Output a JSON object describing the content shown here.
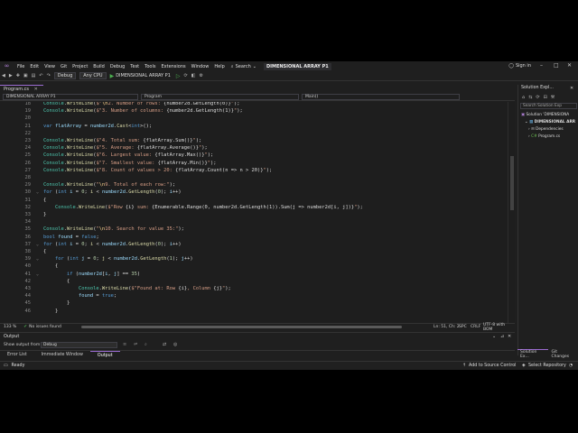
{
  "menubar": {
    "items": [
      "File",
      "Edit",
      "View",
      "Git",
      "Project",
      "Build",
      "Debug",
      "Test",
      "Tools",
      "Extensions",
      "Window",
      "Help"
    ],
    "search_label": "Search",
    "solution_name": "DIMENSIONAL ARRAY P1",
    "sign_in": "Sign in"
  },
  "toolbar": {
    "config": "Debug",
    "platform": "Any CPU",
    "run_target": "DIMENSIONAL ARRAY P1"
  },
  "tabs": [
    {
      "label": "Program.cs"
    }
  ],
  "navbar": {
    "project": "DIMENSIONAL ARRAY P1",
    "class": "Program",
    "member": "Main()"
  },
  "code": {
    "lines": [
      {
        "n": "18",
        "t": "Console.WriteLine($\"\\n2. Number of rows: {number2d.GetLength(0)}\");"
      },
      {
        "n": "19",
        "t": "Console.WriteLine($\"3. Number of columns: {number2d.GetLength(1)}\");"
      },
      {
        "n": "20",
        "t": ""
      },
      {
        "n": "21",
        "t": "var flatArray = number2d.Cast<int>();"
      },
      {
        "n": "22",
        "t": ""
      },
      {
        "n": "23",
        "t": "Console.WriteLine($\"4. Total sum: {flatArray.Sum()}\");"
      },
      {
        "n": "24",
        "t": "Console.WriteLine($\"5. Average: {flatArray.Average()}\");"
      },
      {
        "n": "25",
        "t": "Console.WriteLine($\"6. Largest value: {flatArray.Max()}\");"
      },
      {
        "n": "26",
        "t": "Console.WriteLine($\"7. Smallest value: {flatArray.Min()}\");"
      },
      {
        "n": "27",
        "t": "Console.WriteLine($\"8. Count of values > 20: {flatArray.Count(n => n > 20)}\");"
      },
      {
        "n": "28",
        "t": ""
      },
      {
        "n": "29",
        "t": "Console.WriteLine(\"\\n9. Total of each row:\");"
      },
      {
        "n": "30",
        "t": "for (int i = 0; i < number2d.GetLength(0); i++)"
      },
      {
        "n": "31",
        "t": "{"
      },
      {
        "n": "32",
        "t": "    Console.WriteLine($\"Row {i} sum: {Enumerable.Range(0, number2d.GetLength(1)).Sum(j => number2d[i, j])}\");"
      },
      {
        "n": "33",
        "t": "}"
      },
      {
        "n": "34",
        "t": ""
      },
      {
        "n": "35",
        "t": "Console.WriteLine(\"\\n10. Search for value 35:\");"
      },
      {
        "n": "36",
        "t": "bool found = false;"
      },
      {
        "n": "37",
        "t": "for (int i = 0; i < number2d.GetLength(0); i++)"
      },
      {
        "n": "38",
        "t": "{"
      },
      {
        "n": "39",
        "t": "    for (int j = 0; j < number2d.GetLength(1); j++)"
      },
      {
        "n": "40",
        "t": "    {"
      },
      {
        "n": "41",
        "t": "        if (number2d[i, j] == 35)"
      },
      {
        "n": "42",
        "t": "        {"
      },
      {
        "n": "43",
        "t": "            Console.WriteLine($\"Found at: Row {i}, Column {j}\");"
      },
      {
        "n": "44",
        "t": "            found = true;"
      },
      {
        "n": "45",
        "t": "        }"
      },
      {
        "n": "46",
        "t": "    }"
      }
    ]
  },
  "editor_status": {
    "zoom": "133 %",
    "issues": "No issues found",
    "position": "Ln: 51, Ch: 2",
    "spc": "SPC",
    "crlf": "CRLF",
    "encoding": "UTF-8 with BOM"
  },
  "output": {
    "title": "Output",
    "show_from_label": "Show output from:",
    "show_from_value": "Debug"
  },
  "bottom_tabs": [
    "Error List",
    "Immediate Window",
    "Output"
  ],
  "statusbar": {
    "ready": "Ready",
    "source_control": "Add to Source Control",
    "repository": "Select Repository"
  },
  "solution_explorer": {
    "title": "Solution Expl...",
    "search_placeholder": "Search Solution Exp",
    "tree": [
      {
        "label": "Solution 'DIMENSIONA",
        "indent": 0
      },
      {
        "label": "DIMENSIONAL ARR",
        "indent": 1
      },
      {
        "label": "Dependencies",
        "indent": 2
      },
      {
        "label": "Program.cs",
        "indent": 2
      }
    ],
    "bottom_tabs": [
      "Solution Ex...",
      "Git Changes"
    ]
  }
}
